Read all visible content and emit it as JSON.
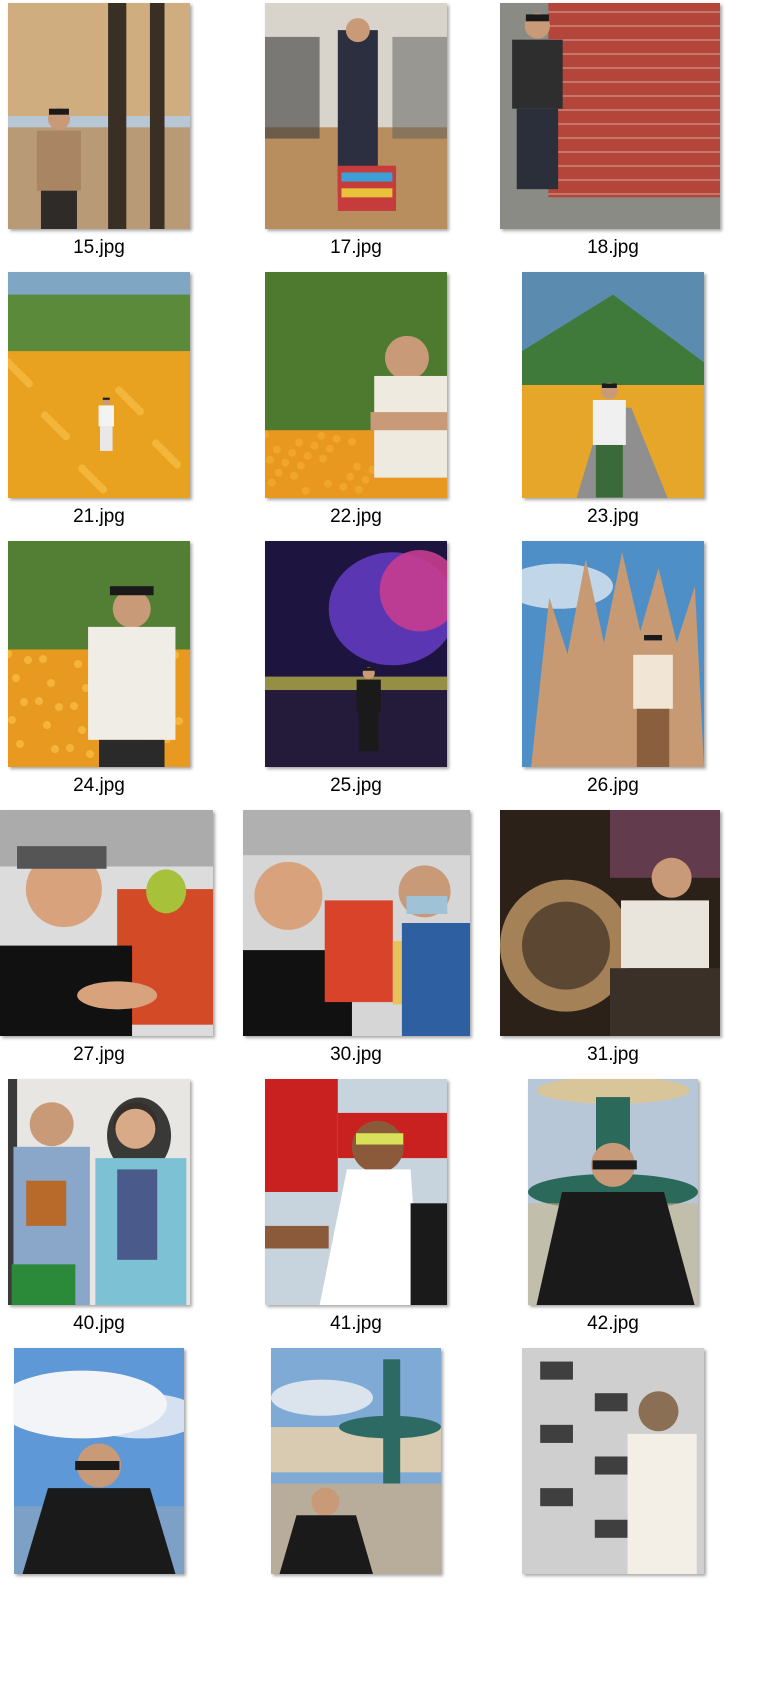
{
  "files": [
    {
      "name": "15.jpg",
      "icon": "photo-thumbnail-icon",
      "palette": [
        "#d9a35a",
        "#8a6a3c",
        "#b8c7d6",
        "#3a2f24"
      ],
      "subject": "man-with-trees"
    },
    {
      "name": "17.jpg",
      "icon": "photo-thumbnail-icon",
      "palette": [
        "#b98e5f",
        "#2b2f3f",
        "#d9d4cb",
        "#c63b3b"
      ],
      "subject": "man-in-store"
    },
    {
      "name": "18.jpg",
      "icon": "photo-thumbnail-icon",
      "palette": [
        "#b4453a",
        "#2e2e2e",
        "#8b8b86",
        "#c9b8a5"
      ],
      "subject": "man-at-brick-wall"
    },
    {
      "name": "21.jpg",
      "icon": "photo-thumbnail-icon",
      "palette": [
        "#e8a21f",
        "#5b8a3a",
        "#7fa6c3",
        "#f3f3f3"
      ],
      "subject": "flower-field"
    },
    {
      "name": "22.jpg",
      "icon": "photo-thumbnail-icon",
      "palette": [
        "#e8971f",
        "#4d7a2f",
        "#efeae0",
        "#2c2c2c"
      ],
      "subject": "man-arms-crossed"
    },
    {
      "name": "23.jpg",
      "icon": "photo-thumbnail-icon",
      "palette": [
        "#5c8bb0",
        "#3f7a3a",
        "#8f8f8f",
        "#e6a62a"
      ],
      "subject": "man-on-road"
    },
    {
      "name": "24.jpg",
      "icon": "photo-thumbnail-icon",
      "palette": [
        "#e89a20",
        "#537f34",
        "#f0ede6",
        "#2a2a2a"
      ],
      "subject": "man-in-flowers"
    },
    {
      "name": "25.jpg",
      "icon": "photo-thumbnail-icon",
      "palette": [
        "#1d1440",
        "#c83d8f",
        "#6a3fcf",
        "#e6e04a"
      ],
      "subject": "night-lights"
    },
    {
      "name": "26.jpg",
      "icon": "photo-thumbnail-icon",
      "palette": [
        "#c79a73",
        "#4f8fc7",
        "#8a5f3e",
        "#f1e6d6"
      ],
      "subject": "cathedral"
    },
    {
      "name": "27.jpg",
      "icon": "photo-thumbnail-icon",
      "palette": [
        "#111111",
        "#d8a27c",
        "#d34a26",
        "#a7c23a"
      ],
      "subject": "selfie-cap"
    },
    {
      "name": "30.jpg",
      "icon": "photo-thumbnail-icon",
      "palette": [
        "#111111",
        "#d8a27c",
        "#2e5fa1",
        "#e9c15a"
      ],
      "subject": "two-men-selfie"
    },
    {
      "name": "31.jpg",
      "icon": "photo-thumbnail-icon",
      "palette": [
        "#2b2119",
        "#c49a66",
        "#e9e4dc",
        "#b7639b"
      ],
      "subject": "man-by-sphere"
    },
    {
      "name": "40.jpg",
      "icon": "photo-thumbnail-icon",
      "palette": [
        "#8aa6c9",
        "#7cc2d4",
        "#2b8a3a",
        "#e8e1d8"
      ],
      "subject": "couple-with-gift"
    },
    {
      "name": "41.jpg",
      "icon": "photo-thumbnail-icon",
      "palette": [
        "#c8211f",
        "#ffffff",
        "#8a5a3a",
        "#c7d4dd"
      ],
      "subject": "man-in-tank-top"
    },
    {
      "name": "42.jpg",
      "icon": "photo-thumbnail-icon",
      "palette": [
        "#2b6a5a",
        "#1a1a1a",
        "#d8c69a",
        "#b7c7d8"
      ],
      "subject": "man-at-fountain"
    },
    {
      "name": "",
      "icon": "photo-thumbnail-icon",
      "palette": [
        "#5f98d6",
        "#f2f4f7",
        "#1a1a1a",
        "#9aa7b5"
      ],
      "subject": "man-sky"
    },
    {
      "name": "",
      "icon": "photo-thumbnail-icon",
      "palette": [
        "#7faad6",
        "#d8cbb2",
        "#2d6a64",
        "#1a1a1a"
      ],
      "subject": "fountain-square"
    },
    {
      "name": "",
      "icon": "photo-thumbnail-icon",
      "palette": [
        "#cfcfcf",
        "#1a1a1a",
        "#f3efe6",
        "#8b6f55"
      ],
      "subject": "man-calligraphy"
    }
  ]
}
